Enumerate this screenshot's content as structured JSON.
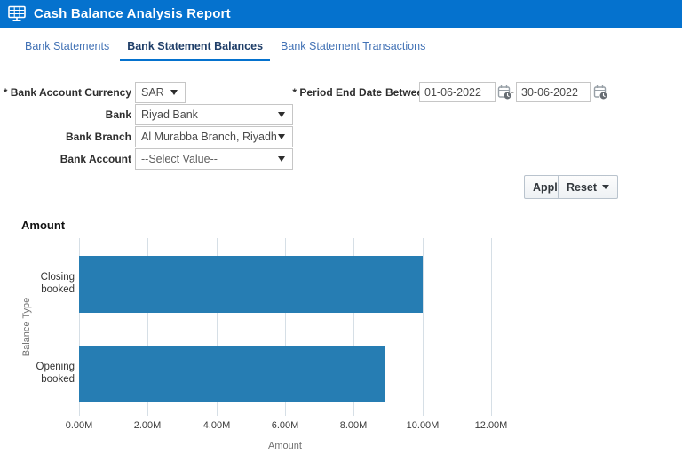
{
  "header": {
    "title": "Cash Balance Analysis Report",
    "icon": "report-monitor-icon",
    "bar_color": "#0572ce"
  },
  "tabs": [
    {
      "label": "Bank Statements",
      "active": false
    },
    {
      "label": "Bank Statement Balances",
      "active": true
    },
    {
      "label": "Bank Statement Transactions",
      "active": false
    }
  ],
  "filters": {
    "currency": {
      "label": "* Bank Account Currency",
      "value": "SAR"
    },
    "bank": {
      "label": "Bank",
      "value": "Riyad Bank"
    },
    "bank_branch": {
      "label": "Bank Branch",
      "value": "Al Murabba Branch, Riyadh"
    },
    "bank_account": {
      "label": "Bank Account",
      "value": "--Select Value--"
    },
    "period_end_date": {
      "label": "* Period End Date",
      "operator": "Between",
      "from": "01-06-2022",
      "separator": "-",
      "to": "30-06-2022"
    }
  },
  "actions": {
    "apply": "Apply",
    "reset": "Reset"
  },
  "chart_data": {
    "type": "bar",
    "orientation": "horizontal",
    "title": "Amount",
    "categories": [
      "Closing booked",
      "Opening booked"
    ],
    "values": [
      10.0,
      8.9
    ],
    "unit": "millions",
    "xlabel": "Amount",
    "ylabel": "Balance Type",
    "xlim": [
      0,
      12
    ],
    "xticks": [
      "0.00M",
      "2.00M",
      "4.00M",
      "6.00M",
      "8.00M",
      "10.00M",
      "12.00M"
    ],
    "bar_color": "#267db3",
    "grid": "vertical-only",
    "legend": "none"
  }
}
